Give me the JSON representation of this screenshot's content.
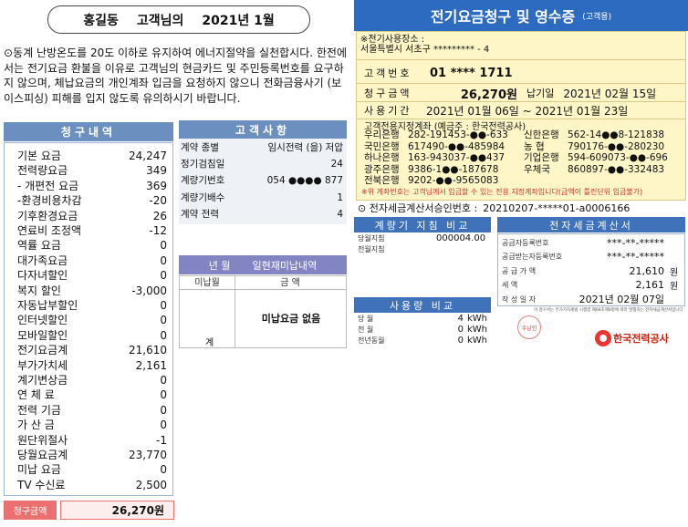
{
  "header_left": {
    "name": "홍길동",
    "suffix": "고객님의",
    "period": "2021년 1월"
  },
  "notice": "⊙동계 난방온도를 20도 이하로 유지하여 에너지절약을 실천합시다. 한전에서는 전기요금 환불을 이유로 고객님의 현금카드 및 주민등록번호를 요구하지 않으며, 체납요금의 개인계좌 입금을 요청하지 않으니 전화금융사기 (보이스피싱) 피해를 입지 않도록 유의하시기 바랍니다.",
  "billing": {
    "title": "청구내역",
    "items": [
      {
        "label": "기본 요금",
        "value": "24,247"
      },
      {
        "label": "전력량요금",
        "value": "349"
      },
      {
        "label": "- 개편전 요금",
        "value": "369"
      },
      {
        "label": "-환경비용차감",
        "value": "-20"
      },
      {
        "label": "기후환경요금",
        "value": "26"
      },
      {
        "label": "연료비 조정액",
        "value": "-12"
      },
      {
        "label": "역률 요금",
        "value": "0"
      },
      {
        "label": "대가족요금",
        "value": "0"
      },
      {
        "label": "다자녀할인",
        "value": "0"
      },
      {
        "label": "복지 할인",
        "value": "-3,000"
      },
      {
        "label": "자동납부할인",
        "value": "0"
      },
      {
        "label": "인터넷할인",
        "value": "0"
      },
      {
        "label": "모바일할인",
        "value": "0"
      },
      {
        "label": "전기요금계",
        "value": "21,610"
      },
      {
        "label": "부가가치세",
        "value": "2,161"
      },
      {
        "label": "계기변상금",
        "value": "0"
      },
      {
        "label": "연 체 료",
        "value": "0"
      },
      {
        "label": "전력 기금",
        "value": "0"
      },
      {
        "label": "가 산 금",
        "value": "0"
      },
      {
        "label": "원단위절사",
        "value": "-1"
      },
      {
        "label": "당월요금계",
        "value": "23,770"
      },
      {
        "label": "미납 요금",
        "value": "0"
      },
      {
        "label": "TV 수신료",
        "value": "2,500"
      }
    ],
    "total_label": "청구금액",
    "total_value": "26,270원"
  },
  "customer": {
    "title": "고객사항",
    "rows": [
      {
        "label": "계약 종별",
        "value": "임시전력 (을) 저압"
      },
      {
        "label": "정기검침일",
        "value": "24"
      },
      {
        "label": "계량기번호",
        "value": "054 ●●●● 877"
      },
      {
        "label": "계량기배수",
        "value": "1"
      },
      {
        "label": "계약 전력",
        "value": "4"
      }
    ]
  },
  "unpaid": {
    "head_year": "년 월",
    "head_label": "일현재미납내역",
    "col_month": "미납월",
    "col_amount": "금 액",
    "gye": "계",
    "none_text": "미납요금 없음"
  },
  "receipt": {
    "title": "전기요금청구 및 영수증",
    "subtitle": "(고객용)",
    "address_label": "※전기사용장소 :",
    "address": "서울특별시 서초구 ********* - 4",
    "customer_no_label": "고객번호",
    "customer_no": "01 **** 1711",
    "amount_label": "청구금액",
    "amount": "26,270원",
    "due_label": "납기일",
    "due": "2021년 02월 15일",
    "period_label": "사용기간",
    "period": "2021년 01월 06일 ~ 2021년 01월 23일",
    "bank_title": "고객전용지정계좌 (예금주 : 한국전력공사)",
    "banks": [
      [
        {
          "n": "우리은행",
          "a": "282-191453-●●-633"
        },
        {
          "n": "신한은행",
          "a": "562-14●●8-121838"
        }
      ],
      [
        {
          "n": "국민은행",
          "a": "617490-●●-485984"
        },
        {
          "n": "농 협",
          "a": "790176-●●-280230"
        }
      ],
      [
        {
          "n": "하나은행",
          "a": "163-943037-●●437"
        },
        {
          "n": "기업은행",
          "a": "594-609073-●●-696"
        }
      ],
      [
        {
          "n": "광주은행",
          "a": "9386-1●●-187678"
        },
        {
          "n": "우체국",
          "a": "860897-●●-332483"
        }
      ],
      [
        {
          "n": "전북은행",
          "a": "9202-●●-9565083"
        },
        {
          "n": "",
          "a": ""
        }
      ]
    ],
    "warning": "※위 계좌번호는 고객님께서 입금할 수 있는 전용 지정계좌입니다(금액이 틀린단위 입금불가)",
    "invoice_label": "⊙ 전자세금계산서승인번호 :",
    "invoice_no": "20210207-*****01-a0006166"
  },
  "meter": {
    "title": "계량기 지침 비교",
    "rows": [
      {
        "label": "당월지침",
        "value": "000004.00"
      },
      {
        "label": "전월지침",
        "value": ""
      }
    ]
  },
  "usage": {
    "title": "사용량 비교",
    "rows": [
      {
        "label": "당 월",
        "value": "4",
        "unit": "kWh"
      },
      {
        "label": "전 월",
        "value": "0",
        "unit": "kWh"
      },
      {
        "label": "전년동월",
        "value": "0",
        "unit": "kWh"
      }
    ]
  },
  "tax": {
    "title": "전자세금계산서",
    "rows": [
      {
        "label": "공급자등록번호",
        "value": "***-**-*****",
        "unit": ""
      },
      {
        "label": "공급받는자등록번호",
        "value": "***-**-*****",
        "unit": ""
      },
      {
        "label": "공 급 가 액",
        "value": "21,610",
        "unit": "원"
      },
      {
        "label": "세 액",
        "value": "2,161",
        "unit": "원"
      },
      {
        "label": "작 성 일 자",
        "value": "2021년 02월 07일",
        "unit": ""
      }
    ],
    "note": "이 청구서는 부가가치세법 시행령 제68조제8항에 따라 발행하는 전자세금계산서입니다.",
    "stamp": "수납인",
    "logo_text": "한국전력공사"
  }
}
